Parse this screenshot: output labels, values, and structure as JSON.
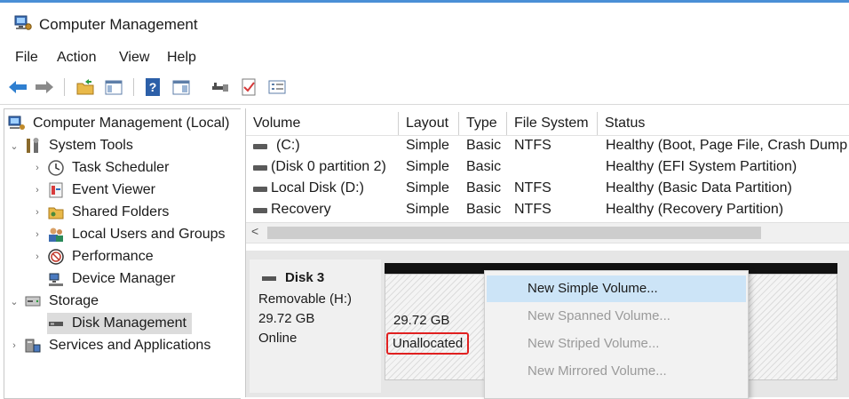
{
  "window": {
    "title": "Computer Management"
  },
  "menu": [
    "File",
    "Action",
    "View",
    "Help"
  ],
  "toolbar": {
    "icons": [
      "back-arrow-icon",
      "forward-arrow-icon",
      "up-folder-icon",
      "show-hide-tree-icon",
      "help-icon",
      "properties-icon",
      "connect-icon",
      "check-icon",
      "list-icon"
    ]
  },
  "tree": {
    "root": "Computer Management (Local)",
    "system_tools": "System Tools",
    "task_scheduler": "Task Scheduler",
    "event_viewer": "Event Viewer",
    "shared_folders": "Shared Folders",
    "local_users": "Local Users and Groups",
    "performance": "Performance",
    "device_manager": "Device Manager",
    "storage": "Storage",
    "disk_management": "Disk Management",
    "services": "Services and Applications"
  },
  "volumes": {
    "headers": {
      "volume": "Volume",
      "layout": "Layout",
      "type": "Type",
      "fs": "File System",
      "status": "Status"
    },
    "rows": [
      {
        "volume": "(C:)",
        "layout": "Simple",
        "type": "Basic",
        "fs": "NTFS",
        "status": "Healthy (Boot, Page File, Crash Dump"
      },
      {
        "volume": "(Disk 0 partition 2)",
        "layout": "Simple",
        "type": "Basic",
        "fs": "",
        "status": "Healthy (EFI System Partition)"
      },
      {
        "volume": "Local Disk (D:)",
        "layout": "Simple",
        "type": "Basic",
        "fs": "NTFS",
        "status": "Healthy (Basic Data Partition)"
      },
      {
        "volume": "Recovery",
        "layout": "Simple",
        "type": "Basic",
        "fs": "NTFS",
        "status": "Healthy (Recovery Partition)"
      }
    ],
    "scroll_left": "<"
  },
  "disk": {
    "name": "Disk 3",
    "kind": "Removable (H:)",
    "size": "29.72 GB",
    "state": "Online",
    "region_size": "29.72 GB",
    "region_label": "Unallocated"
  },
  "context_menu": {
    "items": [
      "New Simple Volume...",
      "New Spanned Volume...",
      "New Striped Volume...",
      "New Mirrored Volume..."
    ]
  }
}
